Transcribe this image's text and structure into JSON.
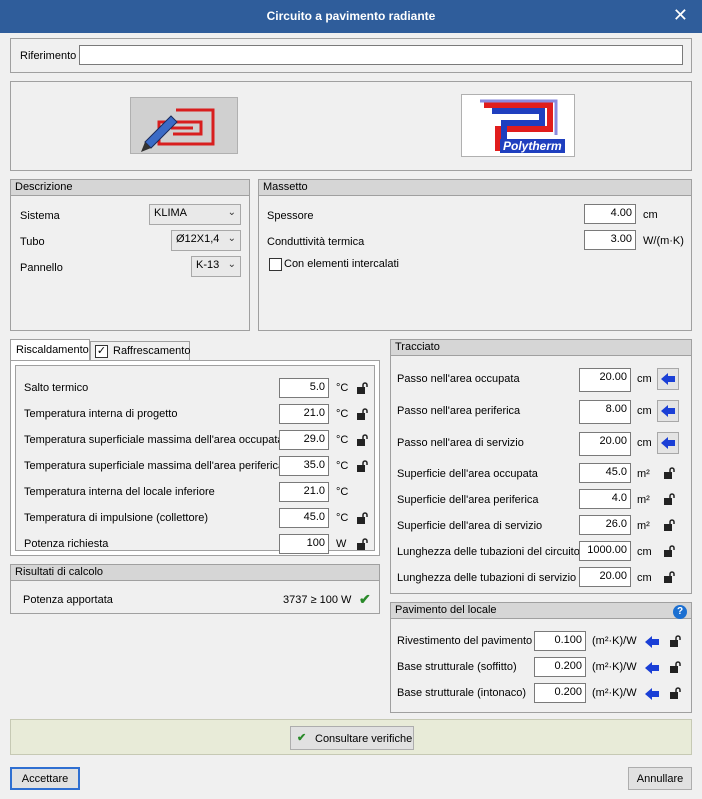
{
  "window": {
    "title": "Circuito a pavimento radiante"
  },
  "riferimento": {
    "label": "Riferimento",
    "value": ""
  },
  "logos": {
    "brand": "Polytherm"
  },
  "descrizione": {
    "title": "Descrizione",
    "sistema_label": "Sistema",
    "sistema_value": "KLIMA",
    "tubo_label": "Tubo",
    "tubo_value": "Ø12X1,4",
    "pannello_label": "Pannello",
    "pannello_value": "K-13"
  },
  "massetto": {
    "title": "Massetto",
    "spessore_label": "Spessore",
    "spessore_value": "4.00",
    "spessore_unit": "cm",
    "cond_label": "Conduttività termica",
    "cond_value": "3.00",
    "cond_unit": "W/(m·K)",
    "elementi_label": "Con elementi intercalati"
  },
  "tabs": {
    "riscaldamento": "Riscaldamento",
    "raffrescamento": "Raffrescamento"
  },
  "riscaldamento": {
    "rows": [
      {
        "label": "Salto termico",
        "value": "5.0",
        "unit": "°C"
      },
      {
        "label": "Temperatura interna di progetto",
        "value": "21.0",
        "unit": "°C"
      },
      {
        "label": "Temperatura superficiale massima dell'area occupata",
        "value": "29.0",
        "unit": "°C"
      },
      {
        "label": "Temperatura superficiale massima dell'area periferica",
        "value": "35.0",
        "unit": "°C"
      },
      {
        "label": "Temperatura interna del locale inferiore",
        "value": "21.0",
        "unit": "°C"
      },
      {
        "label": "Temperatura di impulsione (collettore)",
        "value": "45.0",
        "unit": "°C"
      },
      {
        "label": "Potenza richiesta",
        "value": "100",
        "unit": "W"
      }
    ]
  },
  "risultati": {
    "title": "Risultati di calcolo",
    "label": "Potenza apportata",
    "value": "3737 ≥ 100  W"
  },
  "tracciato": {
    "title": "Tracciato",
    "rows": [
      {
        "label": "Passo nell'area occupata",
        "value": "20.00",
        "unit": "cm"
      },
      {
        "label": "Passo nell'area periferica",
        "value": "8.00",
        "unit": "cm"
      },
      {
        "label": "Passo nell'area di servizio",
        "value": "20.00",
        "unit": "cm"
      },
      {
        "label": "Superficie dell'area occupata",
        "value": "45.0",
        "unit": "m²"
      },
      {
        "label": "Superficie dell'area periferica",
        "value": "4.0",
        "unit": "m²"
      },
      {
        "label": "Superficie dell'area di servizio",
        "value": "26.0",
        "unit": "m²"
      },
      {
        "label": "Lunghezza delle tubazioni del circuito",
        "value": "1000.00",
        "unit": "cm"
      },
      {
        "label": "Lunghezza delle tubazioni di servizio",
        "value": "20.00",
        "unit": "cm"
      }
    ]
  },
  "pavimento": {
    "title": "Pavimento del locale",
    "rows": [
      {
        "label": "Rivestimento del pavimento",
        "value": "0.100",
        "unit": "(m²·K)/W"
      },
      {
        "label": "Base strutturale (soffitto)",
        "value": "0.200",
        "unit": "(m²·K)/W"
      },
      {
        "label": "Base strutturale (intonaco)",
        "value": "0.200",
        "unit": "(m²·K)/W"
      }
    ]
  },
  "buttons": {
    "consultare": "Consultare verifiche",
    "accettare": "Accettare",
    "annullare": "Annullare"
  },
  "colors": {
    "titlebar": "#2f5d9b",
    "arrow": "#1a3fd6",
    "check": "#2a8a2a"
  }
}
